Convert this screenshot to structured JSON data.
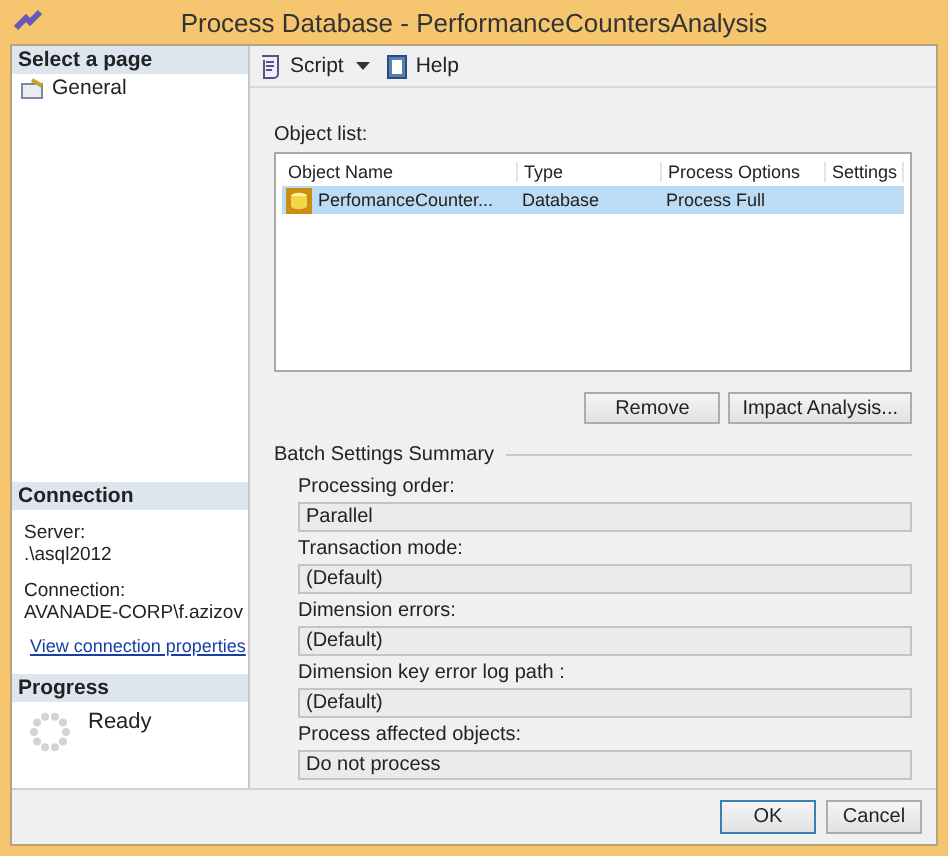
{
  "window": {
    "title": "Process Database - PerformanceCountersAnalysis"
  },
  "sidebar": {
    "header": "Select a page",
    "items": [
      {
        "label": "General"
      }
    ]
  },
  "connection": {
    "header": "Connection",
    "server_label": "Server:",
    "server": ".\\asql2012",
    "connection_label": "Connection:",
    "connection": "AVANADE-CORP\\f.azizov",
    "link": "View connection properties"
  },
  "progress": {
    "header": "Progress",
    "status": "Ready"
  },
  "toolbar": [
    {
      "label": "Script",
      "kind": "dropdown"
    },
    {
      "label": "Help",
      "kind": "button"
    }
  ],
  "object_list": {
    "label": "Object list:",
    "columns": [
      "Object Name",
      "Type",
      "Process Options",
      "Settings"
    ],
    "rows": [
      {
        "cells": [
          "PerfomanceCounter...",
          "Database",
          "Process Full",
          ""
        ],
        "selected": true
      }
    ]
  },
  "list_buttons": [
    "Remove",
    "Impact Analysis..."
  ],
  "batch": {
    "title": "Batch Settings Summary",
    "fields": [
      {
        "label": "Processing order:",
        "value": "Parallel"
      },
      {
        "label": "Transaction mode:",
        "value": "(Default)"
      },
      {
        "label": "Dimension errors:",
        "value": "(Default)"
      },
      {
        "label": "Dimension key error log path :",
        "value": "(Default)"
      },
      {
        "label": "Process affected objects:",
        "value": "Do not process"
      }
    ]
  },
  "buttons": [
    "OK",
    "Cancel"
  ]
}
